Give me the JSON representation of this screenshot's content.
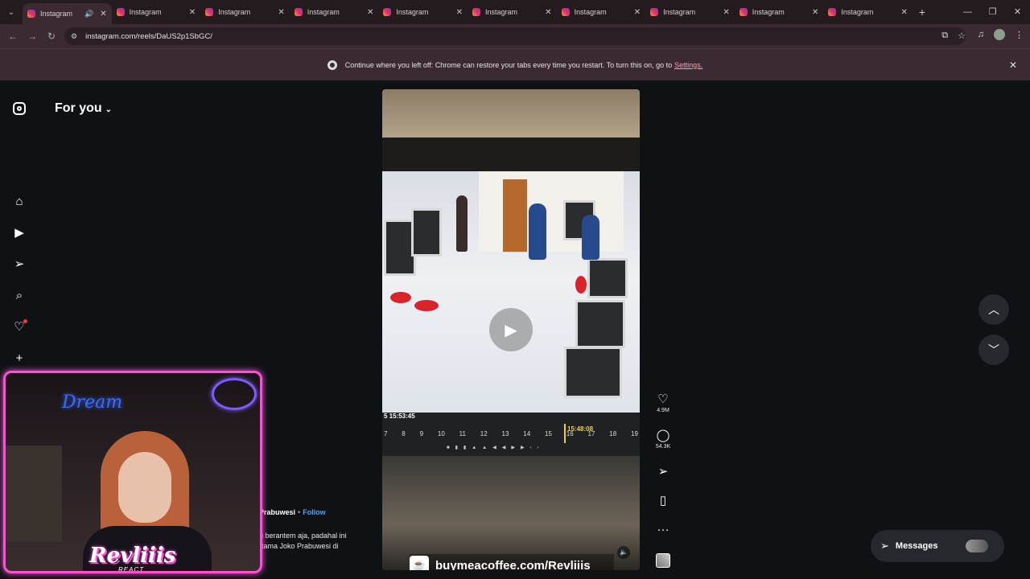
{
  "browser": {
    "tabs": [
      {
        "label": "Instagram",
        "active": true,
        "audio": true
      },
      {
        "label": "Instagram"
      },
      {
        "label": "Instagram"
      },
      {
        "label": "Instagram"
      },
      {
        "label": "Instagram"
      },
      {
        "label": "Instagram"
      },
      {
        "label": "Instagram"
      },
      {
        "label": "Instagram"
      },
      {
        "label": "Instagram"
      },
      {
        "label": "Instagram"
      }
    ],
    "url": "instagram.com/reels/DaUS2p1SbGC/",
    "infobar": {
      "message": "Continue where you left off: Chrome can restore your tabs every time you restart. To turn this on, go to",
      "link": "Settings."
    }
  },
  "page": {
    "feed_title": "For you",
    "reel": {
      "cctv_timestamp": "5 15:53:45",
      "cctv_time_marker": "15:48:08",
      "timeline_ticks": [
        "7",
        "8",
        "9",
        "10",
        "11",
        "12",
        "13",
        "14",
        "15",
        "16",
        "17",
        "18",
        "19"
      ],
      "watermark": "buymeacoffee.com/Revliiis"
    },
    "actions": {
      "likes": "4.9M",
      "comments": "54.3K"
    },
    "caption": {
      "username": "Prabuwesi",
      "follow": "Follow",
      "text_line1": "g berantem aja, padahal ini",
      "text_line2": "rtama Joko Prabuwesi di"
    },
    "messages_label": "Messages"
  },
  "webcam": {
    "neon_sign": "Dream",
    "brand": "Revliiis",
    "brand_sub": "REACT"
  },
  "colors": {
    "chrome_frame": "#241b1f",
    "chrome_toolbar": "#3b2a31",
    "page_bg": "#0f1215",
    "follow_link": "#4aa3ff",
    "notification_dot": "#ff3040",
    "webcam_border": "#ff4fd8"
  }
}
